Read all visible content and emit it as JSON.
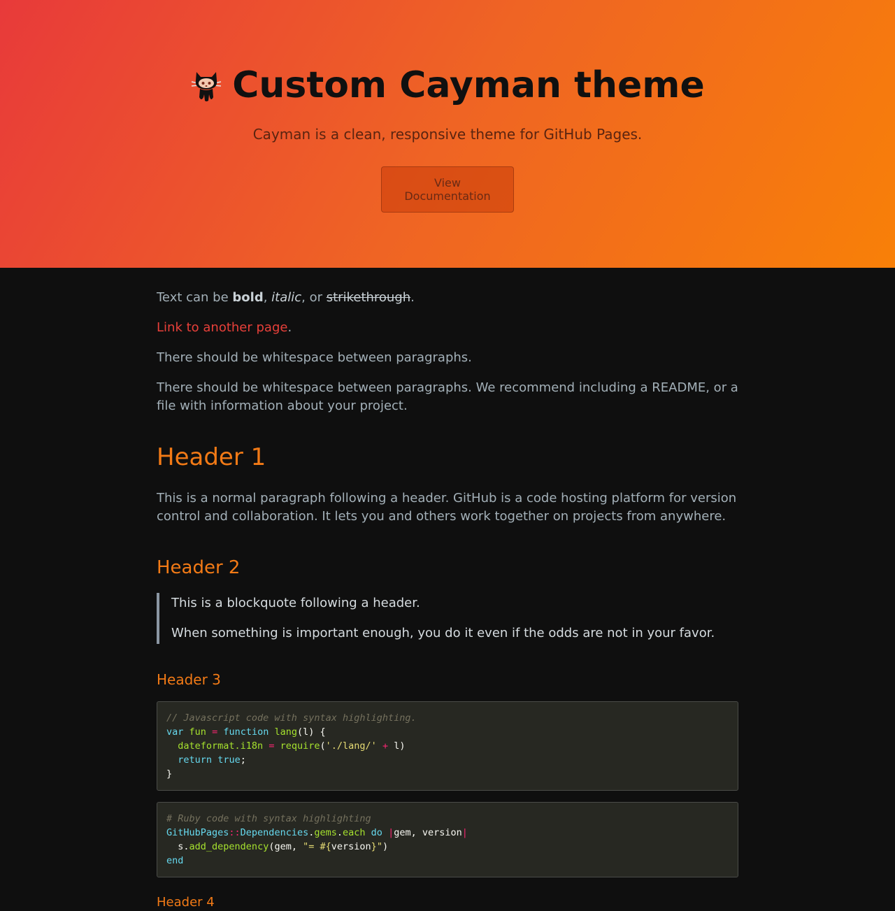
{
  "header": {
    "title": "Custom Cayman theme",
    "tagline": "Cayman is a clean, responsive theme for GitHub Pages.",
    "button_label": "View Documentation",
    "logo_icon": "octocat-icon"
  },
  "content": {
    "p1": {
      "prefix": "Text can be ",
      "bold": "bold",
      "sep1": ", ",
      "italic": "italic",
      "sep2": ", or ",
      "strike": "strikethrough",
      "suffix": "."
    },
    "link": {
      "text": "Link to another page",
      "suffix": "."
    },
    "p2": "There should be whitespace between paragraphs.",
    "p3": "There should be whitespace between paragraphs. We recommend including a README, or a file with information about your project.",
    "h1": "Header 1",
    "p4": "This is a normal paragraph following a header. GitHub is a code hosting platform for version control and collaboration. It lets you and others work together on projects from anywhere.",
    "h2": "Header 2",
    "quote": [
      "This is a blockquote following a header.",
      "When something is important enough, you do it even if the odds are not in your favor."
    ],
    "h3": "Header 3",
    "js": {
      "comment": "// Javascript code with syntax highlighting.",
      "l2_var": "var",
      "l2_fun": "fun",
      "l2_eq": "=",
      "l2_function": "function",
      "l2_lang": "lang",
      "l2_rest": "(l) {",
      "l3_a": "dateformat.i18n",
      "l3_eq": "=",
      "l3_req": "require",
      "l3_open": "(",
      "l3_str": "'./lang/'",
      "l3_plus": "+",
      "l3_end": "l)",
      "l4_return": "return",
      "l4_true": "true",
      "l4_semi": ";",
      "l5": "}"
    },
    "ruby": {
      "comment": "# Ruby code with syntax highlighting",
      "l2_a": "GitHubPages",
      "l2_sep": "::",
      "l2_b": "Dependencies",
      "l2_dot1": ".",
      "l2_gems": "gems",
      "l2_dot2": ".",
      "l2_each": "each",
      "l2_do": "do",
      "l2_pipe1": "|",
      "l2_args": "gem, version",
      "l2_pipe2": "|",
      "l3_s": "s.",
      "l3_fn": "add_dependency",
      "l3_open": "(gem, ",
      "l3_str1": "\"= ",
      "l3_interp": "#{",
      "l3_var": "version",
      "l3_interp_end": "}",
      "l3_str2": "\"",
      "l3_close": ")",
      "l4": "end"
    },
    "h4": "Header 4"
  },
  "colors": {
    "accent": "#f27a16",
    "link": "#e8403a",
    "background": "#0f0f0f",
    "code_bg": "#272822"
  }
}
